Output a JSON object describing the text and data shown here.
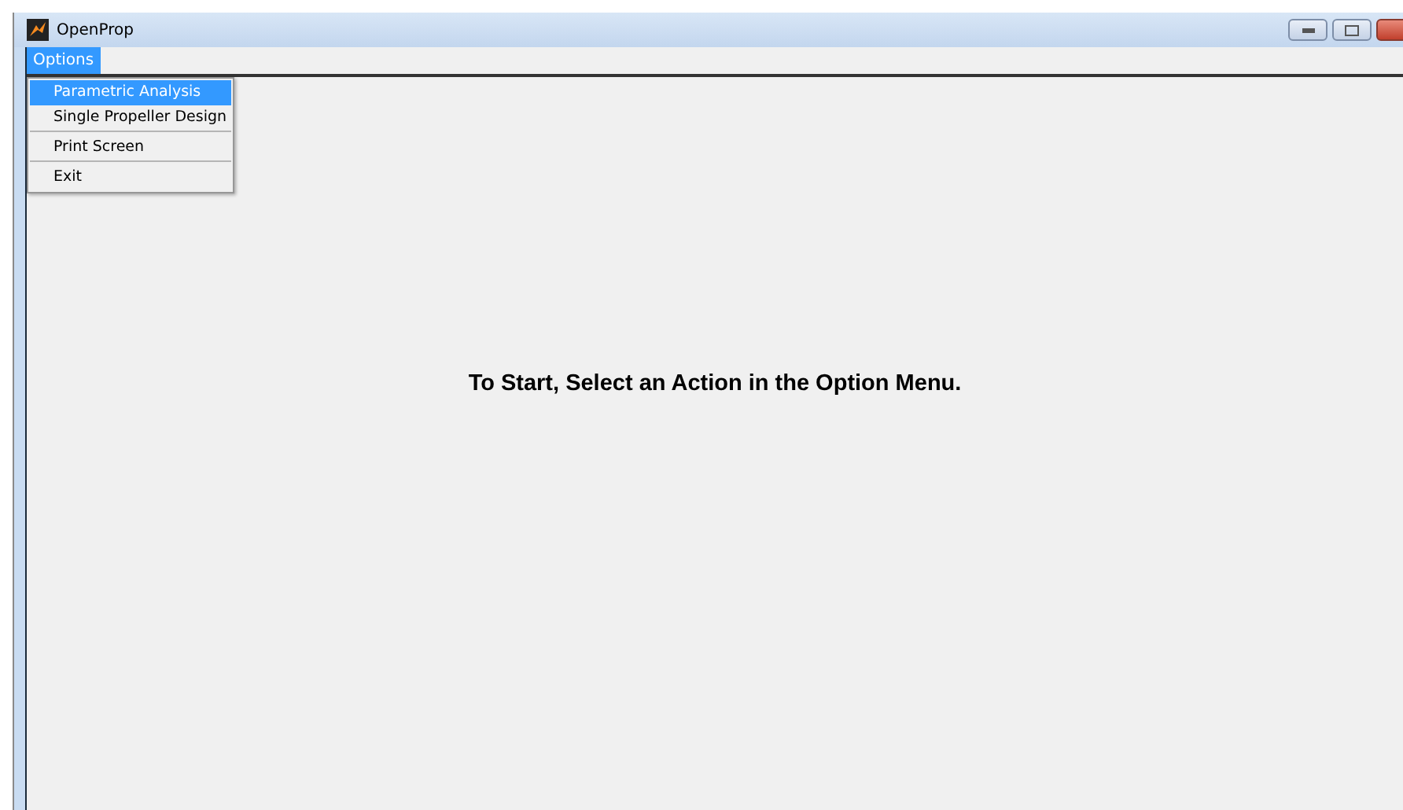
{
  "window": {
    "title": "OpenProp"
  },
  "menu_bar": [
    {
      "label": "Options",
      "selected": true
    }
  ],
  "dropdown": [
    {
      "label": "Parametric Analysis",
      "selected": true,
      "separator_after": false
    },
    {
      "label": "Single Propeller Design",
      "selected": false,
      "separator_after": true
    },
    {
      "label": "Print Screen",
      "selected": false,
      "separator_after": true
    },
    {
      "label": "Exit",
      "selected": false,
      "separator_after": false
    }
  ],
  "message": "To Start, Select an Action in the Option Menu."
}
